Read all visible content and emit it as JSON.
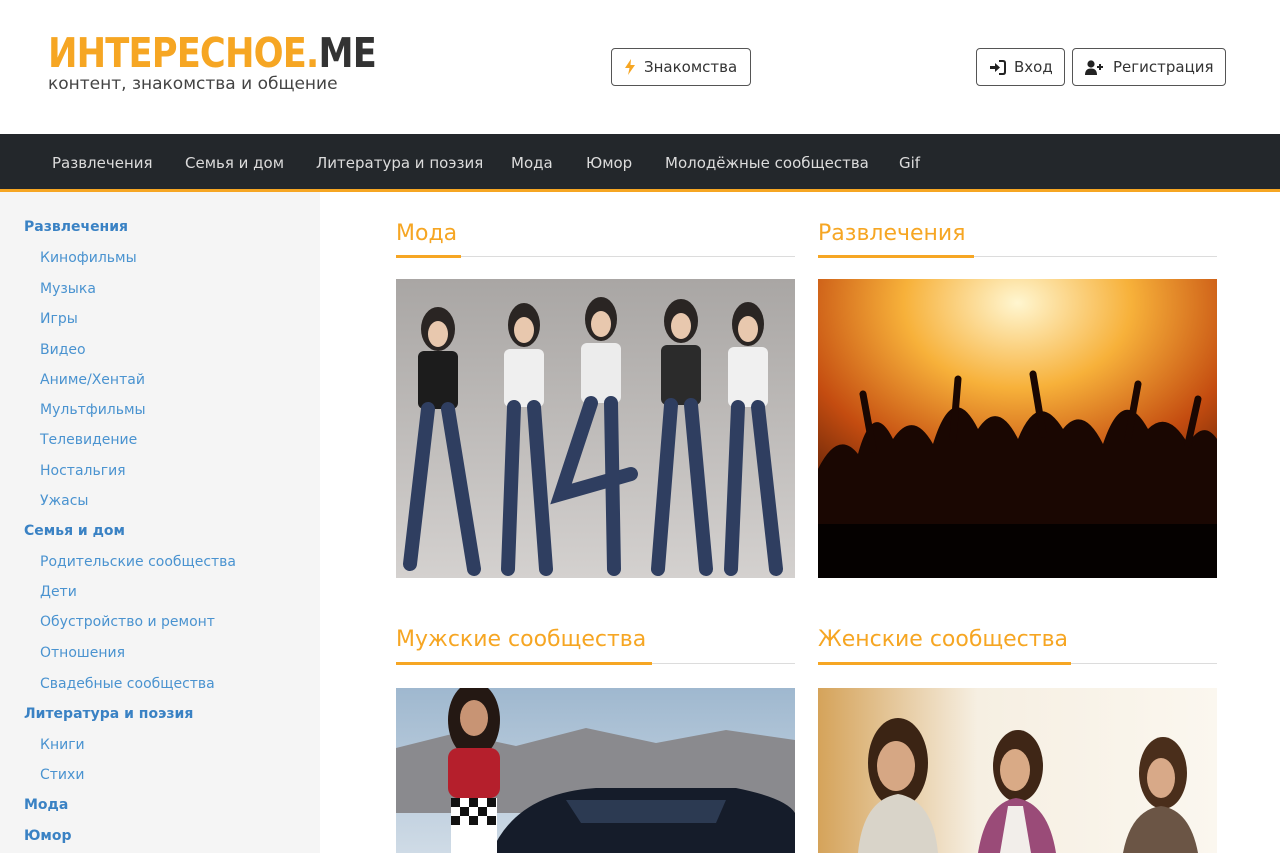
{
  "header": {
    "logo": {
      "part1": "ИНТЕРЕСНОЕ.",
      "part2": "ME",
      "tagline": "контент, знакомства и общение"
    },
    "dating_button": {
      "label": "Знакомства",
      "icon": "lightning-icon"
    },
    "login_button": {
      "label": "Вход",
      "icon": "sign-in-icon"
    },
    "register_button": {
      "label": "Регистрация",
      "icon": "user-plus-icon"
    }
  },
  "nav": {
    "items": [
      "Развлечения",
      "Семья и дом",
      "Литература и поэзия",
      "Мода",
      "Юмор",
      "Молодёжные сообщества",
      "Gif"
    ]
  },
  "sidebar": {
    "cat1": "Развлечения",
    "cat1_items": [
      "Кинофильмы",
      "Музыка",
      "Игры",
      "Видео",
      "Аниме/Хентай",
      "Мультфильмы",
      "Телевидение",
      "Ностальгия",
      "Ужасы"
    ],
    "cat2": "Семья и дом",
    "cat2_items": [
      "Родительские сообщества",
      "Дети",
      "Обустройство и ремонт",
      "Отношения",
      "Свадебные сообщества"
    ],
    "cat3": "Литература и поэзия",
    "cat3_items": [
      "Книги",
      "Стихи"
    ],
    "cat4": "Мода",
    "cat5": "Юмор"
  },
  "sections": [
    {
      "title": "Мода"
    },
    {
      "title": "Развлечения"
    },
    {
      "title": "Мужские сообщества"
    },
    {
      "title": "Женские сообщества"
    }
  ],
  "colors": {
    "accent": "#f6a623",
    "nav_bg": "#23272b",
    "link": "#3a82c4",
    "sidebar_bg": "#f5f5f5"
  }
}
